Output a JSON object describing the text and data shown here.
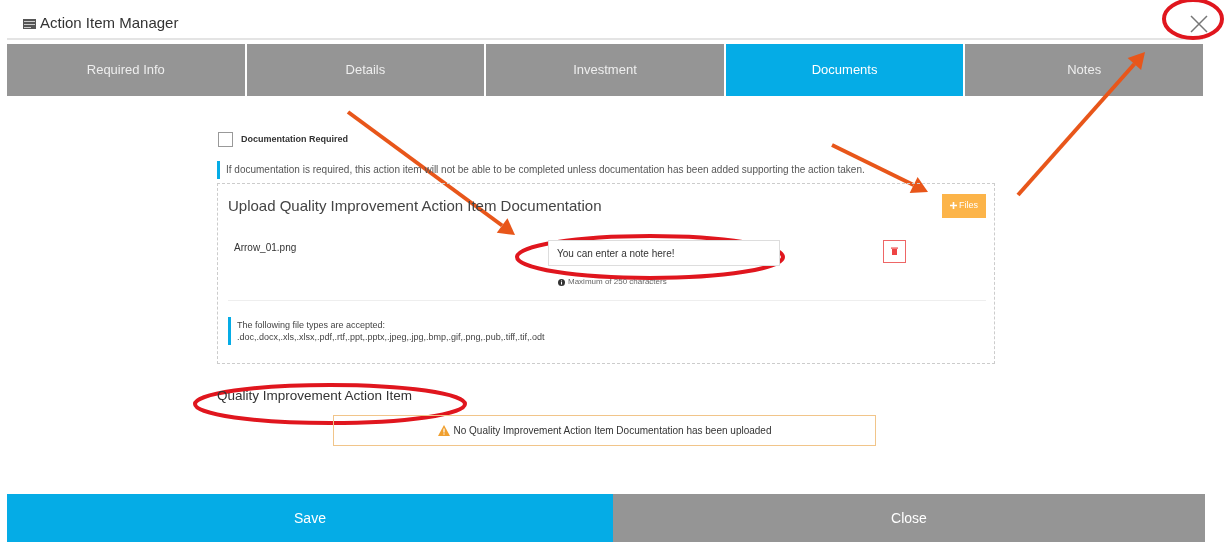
{
  "window": {
    "title": "Action Item Manager"
  },
  "tabs": [
    {
      "label": "Required Info",
      "selected": false
    },
    {
      "label": "Details",
      "selected": false
    },
    {
      "label": "Investment",
      "selected": false
    },
    {
      "label": "Documents",
      "selected": true
    },
    {
      "label": "Notes",
      "selected": false
    }
  ],
  "documentation_required": {
    "label": "Documentation Required",
    "checked": false
  },
  "notice": "If documentation is required, this action item will not be able to be completed unless documentation has been added supporting the action taken.",
  "upload": {
    "heading": "Upload Quality Improvement Action Item Documentation",
    "files_button": "Files",
    "files": [
      {
        "name": "Arrow_01.png",
        "note": "You can enter a note here!",
        "hint": "Maximum of 250 characters"
      }
    ],
    "accepted": [
      "The following file types are accepted:",
      ".doc,.docx,.xls,.xlsx,.pdf,.rtf,.ppt,.pptx,.jpeg,.jpg,.bmp,.gif,.png,.pub,.tiff,.tif,.odt"
    ]
  },
  "section": {
    "heading": "Quality Improvement Action Item",
    "warning": "No Quality Improvement Action Item Documentation has been uploaded"
  },
  "footer_buttons": [
    {
      "label": "Save",
      "kind": "primary"
    },
    {
      "label": "Close",
      "kind": "secondary"
    }
  ]
}
